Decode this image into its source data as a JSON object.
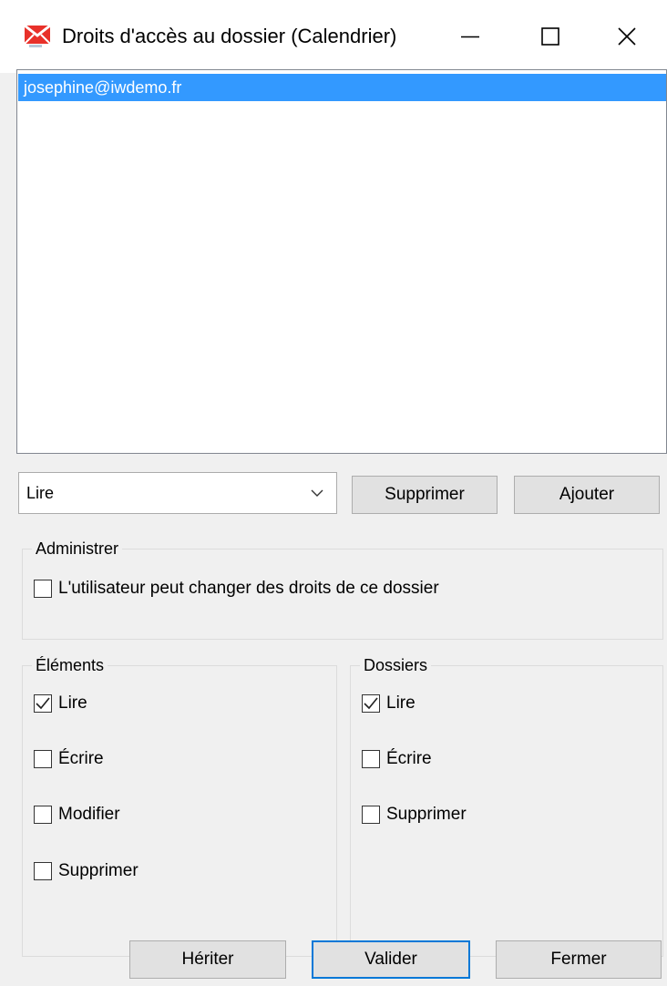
{
  "window": {
    "title": "Droits d'accès au dossier (Calendrier)",
    "icon": "mail-app-icon"
  },
  "users": [
    {
      "email": "josephine@iwdemo.fr",
      "selected": true
    }
  ],
  "rights_combo": {
    "value": "Lire"
  },
  "buttons": {
    "remove": "Supprimer",
    "add": "Ajouter",
    "inherit": "Hériter",
    "validate": "Valider",
    "close": "Fermer"
  },
  "admin_group": {
    "legend": "Administrer",
    "option": {
      "label": "L'utilisateur peut changer des droits de ce dossier",
      "checked": false
    }
  },
  "items_group": {
    "legend": "Éléments",
    "options": [
      {
        "label": "Lire",
        "checked": true
      },
      {
        "label": "Écrire",
        "checked": false
      },
      {
        "label": "Modifier",
        "checked": false
      },
      {
        "label": "Supprimer",
        "checked": false
      }
    ]
  },
  "folders_group": {
    "legend": "Dossiers",
    "options": [
      {
        "label": "Lire",
        "checked": true
      },
      {
        "label": "Écrire",
        "checked": false
      },
      {
        "label": "Supprimer",
        "checked": false
      }
    ]
  },
  "colors": {
    "selection": "#3399ff",
    "default_button_border": "#0078d7",
    "window_bg": "#f0f0f0"
  }
}
